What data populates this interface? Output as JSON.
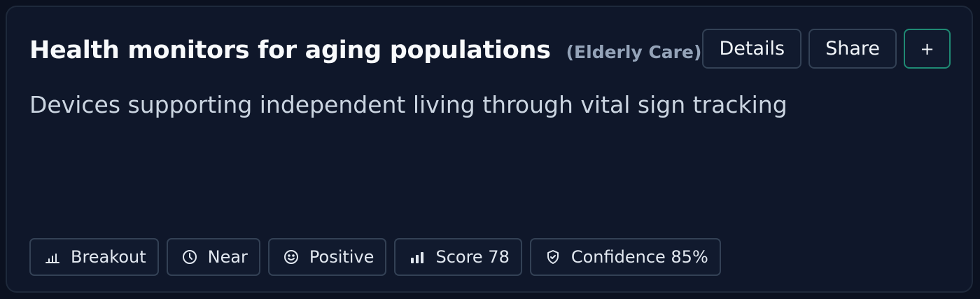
{
  "card": {
    "title": "Health monitors for aging populations",
    "category": "(Elderly Care)",
    "description": "Devices supporting independent living through vital sign tracking"
  },
  "actions": {
    "details_label": "Details",
    "share_label": "Share",
    "add_label": "+"
  },
  "tags": [
    {
      "icon": "bar-chart-icon",
      "label": "Breakout"
    },
    {
      "icon": "clock-icon",
      "label": "Near"
    },
    {
      "icon": "smile-icon",
      "label": "Positive"
    },
    {
      "icon": "signal-bars-icon",
      "label": "Score 78"
    },
    {
      "icon": "shield-check-icon",
      "label": "Confidence 85%"
    }
  ],
  "colors": {
    "background": "#0b1120",
    "card": "#0f172a",
    "border": "#334155",
    "accent": "#1f8a74",
    "title": "#f8fafc",
    "muted": "#94a3b8"
  }
}
